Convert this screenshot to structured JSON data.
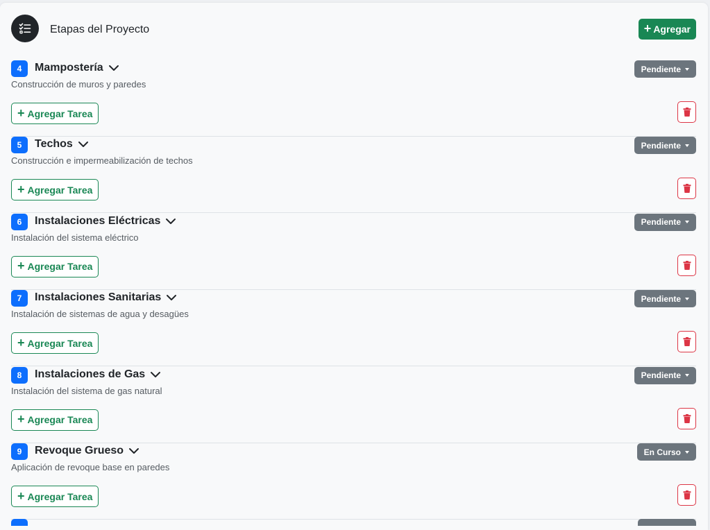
{
  "header": {
    "title": "Etapas del Proyecto",
    "icon": "task-list-icon",
    "add_label": "Agregar"
  },
  "labels": {
    "add_task": "Agregar Tarea"
  },
  "colors": {
    "primary": "#0d6efd",
    "success": "#198754",
    "secondary": "#6c757d",
    "danger": "#dc3545"
  },
  "stages": [
    {
      "number": "4",
      "name": "Mampostería",
      "description": "Construcción de muros y paredes",
      "status": "Pendiente"
    },
    {
      "number": "5",
      "name": "Techos",
      "description": "Construcción e impermeabilización de techos",
      "status": "Pendiente"
    },
    {
      "number": "6",
      "name": "Instalaciones Eléctricas",
      "description": "Instalación del sistema eléctrico",
      "status": "Pendiente"
    },
    {
      "number": "7",
      "name": "Instalaciones Sanitarias",
      "description": "Instalación de sistemas de agua y desagües",
      "status": "Pendiente"
    },
    {
      "number": "8",
      "name": "Instalaciones de Gas",
      "description": "Instalación del sistema de gas natural",
      "status": "Pendiente"
    },
    {
      "number": "9",
      "name": "Revoque Grueso",
      "description": "Aplicación de revoque base en paredes",
      "status": "En Curso"
    }
  ]
}
